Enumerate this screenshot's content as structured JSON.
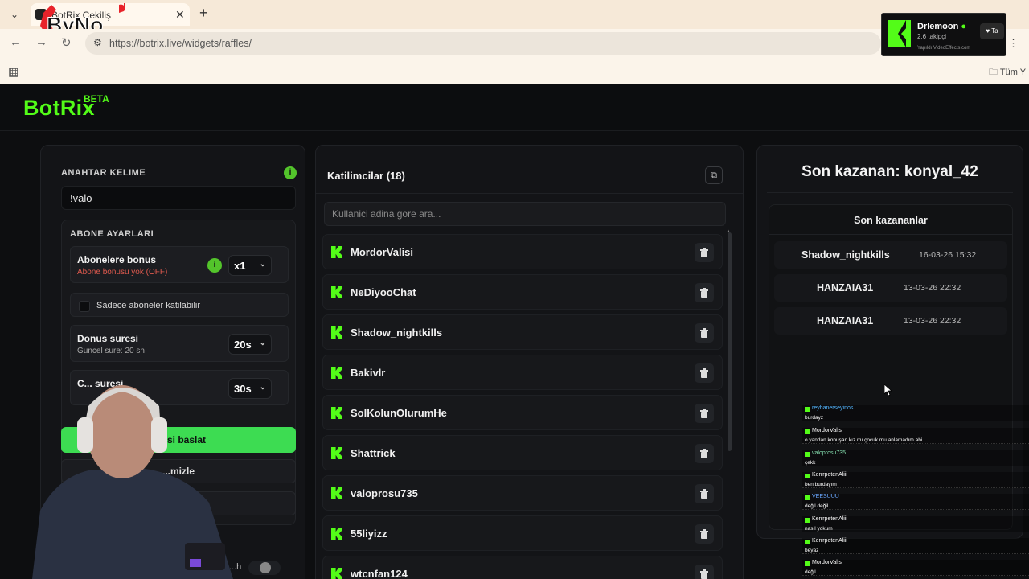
{
  "browser": {
    "tab_title": "BotRix Çekiliş",
    "url": "https://botrix.live/widgets/raffles/",
    "bookmark_folder": "Tüm Y",
    "stream_logo_text": "ByNo"
  },
  "notification": {
    "name": "Drlemoon",
    "followers": "2.6 takipçi",
    "footer": "Yapıldı VideoEffects.com",
    "button": "Ta"
  },
  "app": {
    "brand": "BotRix",
    "beta": "BETA"
  },
  "left": {
    "keyword_label": "ANAHTAR KELIME",
    "keyword_value": "!valo",
    "sub_settings_label": "ABONE AYARLARI",
    "bonus_title": "Abonelere bonus",
    "bonus_desc": "Abone bonusu yok (OFF)",
    "bonus_value": "x1",
    "subs_only_label": "Sadece aboneler katilabilir",
    "spin_title": "Donus suresi",
    "spin_desc": "Guncel sure: 20 sn",
    "spin_value": "20s",
    "second_title": "C... suresi",
    "second_value": "30s",
    "start_button": "...ilisi baslat",
    "button2": "...mizle",
    "button3": "...izle",
    "toggle_label": "...h"
  },
  "participants": {
    "title": "Katilimcilar (18)",
    "search_placeholder": "Kullanici adina gore ara...",
    "items": [
      "MordorValisi",
      "NeDiyooChat",
      "Shadow_nightkills",
      "Bakivlr",
      "SolKolunOlurumHe",
      "Shattrick",
      "valoprosu735",
      "55liyizz",
      "wtcnfan124"
    ]
  },
  "winners": {
    "title": "Son kazanan: konyal_42",
    "subtitle": "Son kazananlar",
    "rows": [
      {
        "name": "Shadow_nightkills",
        "date": "16-03-26 15:32"
      },
      {
        "name": "HANZAIA31",
        "date": "13-03-26 22:32"
      },
      {
        "name": "HANZAIA31",
        "date": "13-03-26 22:32"
      }
    ]
  },
  "chat": [
    {
      "user": "reyhanerseyinos",
      "msg": "burdayz"
    },
    {
      "user": "MordorValisi",
      "msg": "o yandan konuşan kız mı çocuk mu anlamadım abi"
    },
    {
      "user": "valoprosu735",
      "msg": "çekk"
    },
    {
      "user": "KerrrpetenAliii",
      "msg": "ben burdayım"
    },
    {
      "user": "VEESUUU",
      "msg": "değil değil"
    },
    {
      "user": "KerrrpetenAliii",
      "msg": "nasıl yokum"
    },
    {
      "user": "KerrrpetenAliii",
      "msg": "beyaz"
    },
    {
      "user": "MordorValisi",
      "msg": "değil"
    }
  ],
  "colors": {
    "accent": "#53fc18",
    "start_button": "#3ddc52",
    "warning_text": "#e05a4e",
    "panel_bg": "#131417"
  }
}
